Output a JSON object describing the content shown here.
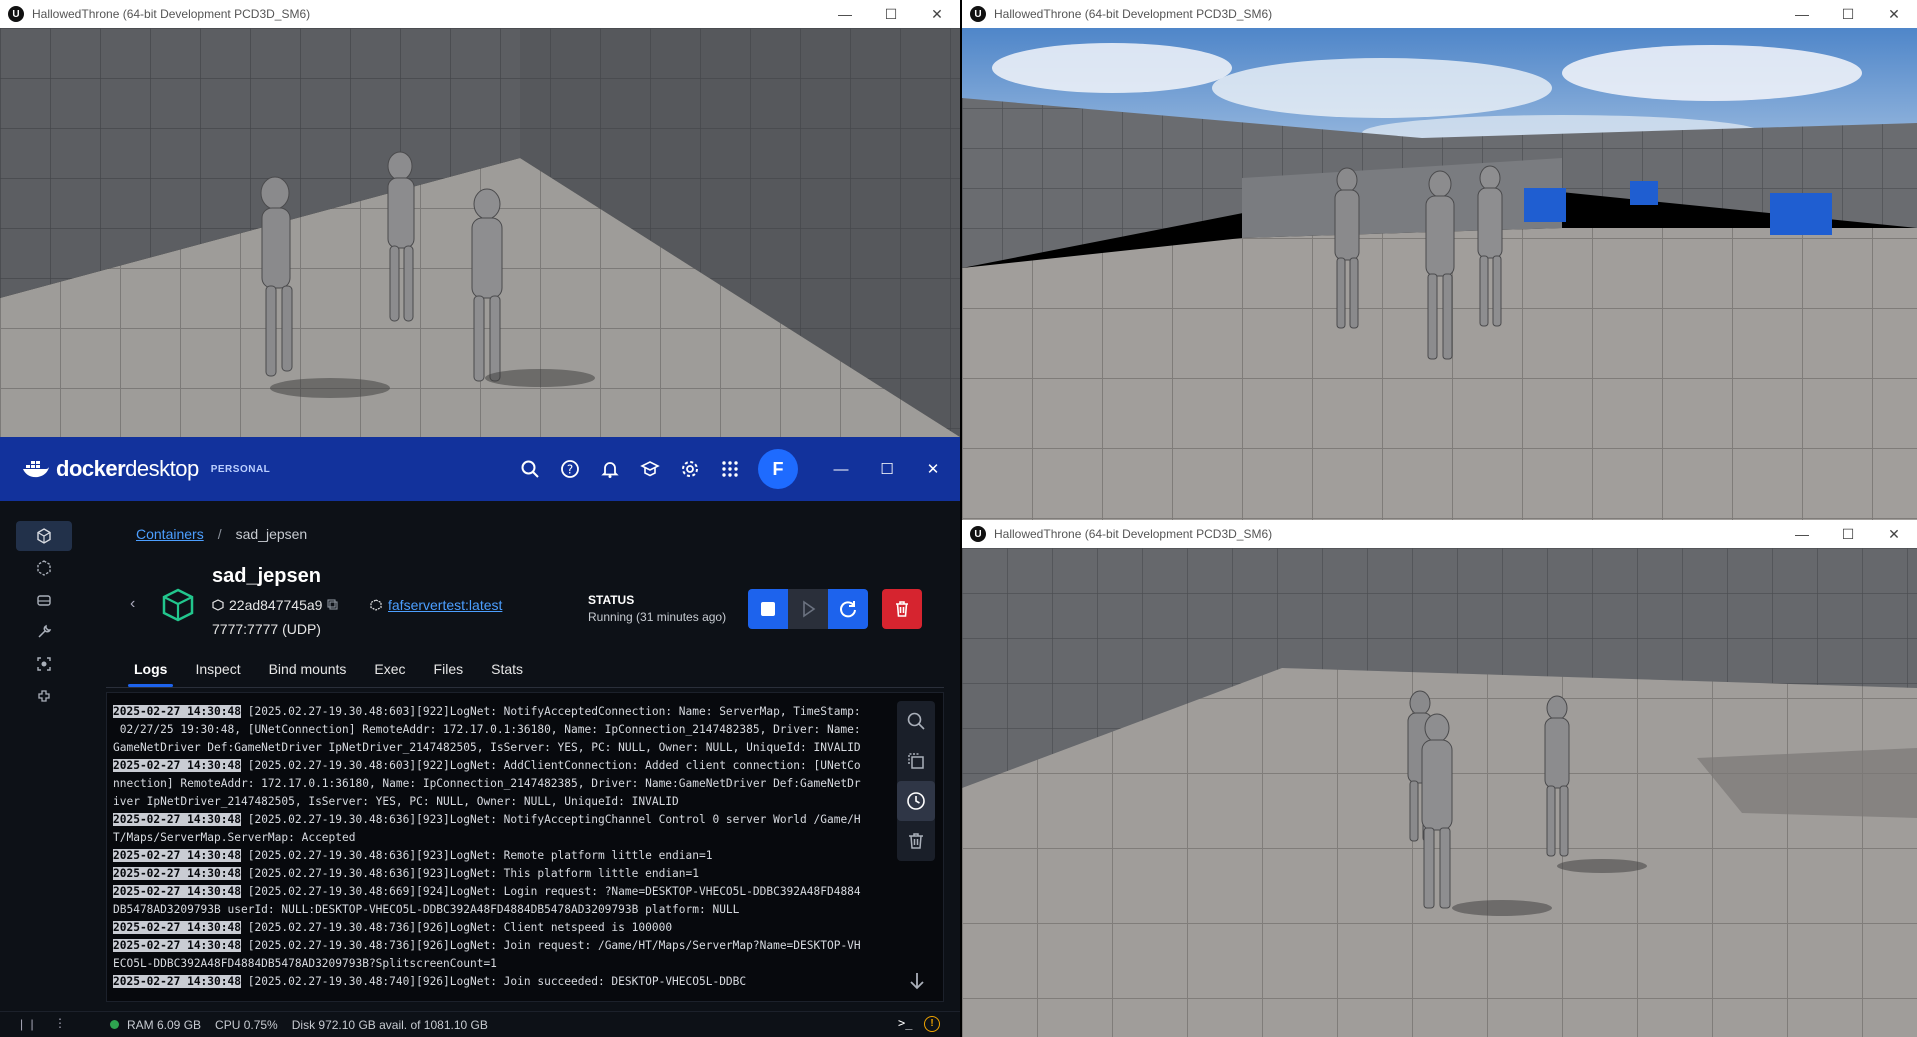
{
  "game_windows": [
    {
      "title": "HallowedThrone (64-bit Development PCD3D_SM6)"
    },
    {
      "title": "HallowedThrone (64-bit Development PCD3D_SM6)"
    },
    {
      "title": "HallowedThrone (64-bit Development PCD3D_SM6)"
    }
  ],
  "window_controls": {
    "minimize": "—",
    "maximize": "☐",
    "close": "✕"
  },
  "docker": {
    "brand": {
      "text_a": "docker",
      "text_b": "desktop",
      "badge": "PERSONAL"
    },
    "header_icons": [
      "search-icon",
      "help-icon",
      "bell-icon",
      "learning-center-icon",
      "settings-icon",
      "apps-grid-icon"
    ],
    "avatar_letter": "F",
    "sidebar": [
      "containers-icon",
      "images-icon",
      "volumes-icon",
      "dev-environments-icon",
      "extensions-icon",
      "add-extension-icon"
    ],
    "breadcrumb": {
      "parent": "Containers",
      "separator": "/",
      "current": "sad_jepsen"
    },
    "container": {
      "name": "sad_jepsen",
      "id": "22ad847745a9",
      "ports": "7777:7777 (UDP)",
      "image": "fafservertest:latest",
      "status_label": "STATUS",
      "status_value": "Running (31 minutes ago)"
    },
    "tabs": [
      "Logs",
      "Inspect",
      "Bind mounts",
      "Exec",
      "Files",
      "Stats"
    ],
    "active_tab": "Logs",
    "logs": [
      {
        "ts": "2025-02-27 14:30:48",
        "text": " [2025.02.27-19.30.48:603][922]LogNet: NotifyAcceptedConnection: Name: ServerMap, TimeStamp:"
      },
      {
        "ts": "",
        "text": " 02/27/25 19:30:48, [UNetConnection] RemoteAddr: 172.17.0.1:36180, Name: IpConnection_2147482385, Driver: Name:"
      },
      {
        "ts": "",
        "text": "GameNetDriver Def:GameNetDriver IpNetDriver_2147482505, IsServer: YES, PC: NULL, Owner: NULL, UniqueId: INVALID"
      },
      {
        "ts": "2025-02-27 14:30:48",
        "text": " [2025.02.27-19.30.48:603][922]LogNet: AddClientConnection: Added client connection: [UNetCo"
      },
      {
        "ts": "",
        "text": "nnection] RemoteAddr: 172.17.0.1:36180, Name: IpConnection_2147482385, Driver: Name:GameNetDriver Def:GameNetDr"
      },
      {
        "ts": "",
        "text": "iver IpNetDriver_2147482505, IsServer: YES, PC: NULL, Owner: NULL, UniqueId: INVALID"
      },
      {
        "ts": "2025-02-27 14:30:48",
        "text": " [2025.02.27-19.30.48:636][923]LogNet: NotifyAcceptingChannel Control 0 server World /Game/H"
      },
      {
        "ts": "",
        "text": "T/Maps/ServerMap.ServerMap: Accepted"
      },
      {
        "ts": "2025-02-27 14:30:48",
        "text": " [2025.02.27-19.30.48:636][923]LogNet: Remote platform little endian=1"
      },
      {
        "ts": "2025-02-27 14:30:48",
        "text": " [2025.02.27-19.30.48:636][923]LogNet: This platform little endian=1"
      },
      {
        "ts": "2025-02-27 14:30:48",
        "text": " [2025.02.27-19.30.48:669][924]LogNet: Login request: ?Name=DESKTOP-VHECO5L-DDBC392A48FD4884"
      },
      {
        "ts": "",
        "text": "DB5478AD3209793B userId: NULL:DESKTOP-VHECO5L-DDBC392A48FD4884DB5478AD3209793B platform: NULL"
      },
      {
        "ts": "2025-02-27 14:30:48",
        "text": " [2025.02.27-19.30.48:736][926]LogNet: Client netspeed is 100000"
      },
      {
        "ts": "2025-02-27 14:30:48",
        "text": " [2025.02.27-19.30.48:736][926]LogNet: Join request: /Game/HT/Maps/ServerMap?Name=DESKTOP-VH"
      },
      {
        "ts": "",
        "text": "ECO5L-DDBC392A48FD4884DB5478AD3209793B?SplitscreenCount=1"
      },
      {
        "ts": "2025-02-27 14:30:48",
        "text": " [2025.02.27-19.30.48:740][926]LogNet: Join succeeded: DESKTOP-VHECO5L-DDBC"
      }
    ],
    "footer": {
      "ram": "RAM 6.09 GB",
      "cpu": "CPU 0.75%",
      "disk": "Disk 972.10 GB avail. of 1081.10 GB"
    }
  },
  "colors": {
    "docker_header": "#12329c",
    "docker_bg": "#0d1117",
    "accent_blue": "#1d63ed",
    "danger_red": "#d6242f",
    "floor": "#9c9a98",
    "wall": "#5d5f63",
    "cube_blue": "#1f5ed1"
  }
}
